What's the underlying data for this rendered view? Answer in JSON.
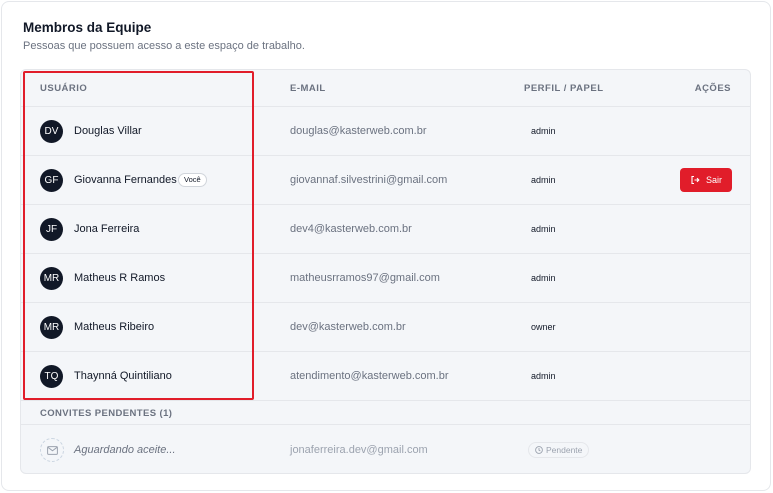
{
  "card": {
    "title": "Membros da Equipe",
    "subtitle": "Pessoas que possuem acesso a este espaço de trabalho."
  },
  "table": {
    "headers": {
      "user": "USUÁRIO",
      "email": "E-MAIL",
      "role": "PERFIL / PAPEL",
      "actions": "AÇÕES"
    },
    "members": [
      {
        "initials": "DV",
        "name": "Douglas Villar",
        "email": "douglas@kasterweb.com.br",
        "role": "admin"
      },
      {
        "initials": "GF",
        "name": "Giovanna Fernandes",
        "badge": "Você",
        "email": "giovannaf.silvestrini@gmail.com",
        "role": "admin",
        "action": "Sair"
      },
      {
        "initials": "JF",
        "name": "Jona Ferreira",
        "email": "dev4@kasterweb.com.br",
        "role": "admin"
      },
      {
        "initials": "MR",
        "name": "Matheus R Ramos",
        "email": "matheusrramos97@gmail.com",
        "role": "admin"
      },
      {
        "initials": "MR",
        "name": "Matheus Ribeiro",
        "email": "dev@kasterweb.com.br",
        "role": "owner"
      },
      {
        "initials": "TQ",
        "name": "Thaynná Quintiliano",
        "email": "atendimento@kasterweb.com.br",
        "role": "admin"
      }
    ]
  },
  "pending": {
    "title": "CONVITES PENDENTES (1)",
    "invites": [
      {
        "name": "Aguardando aceite...",
        "email": "jonaferreira.dev@gmail.com",
        "status": "Pendente"
      }
    ]
  },
  "colors": {
    "accent_red": "#e11d2a",
    "avatar_bg": "#111827"
  },
  "icons": {
    "leave": "logout-icon",
    "pending_avatar": "mail-icon",
    "pending_status": "clock-icon"
  }
}
